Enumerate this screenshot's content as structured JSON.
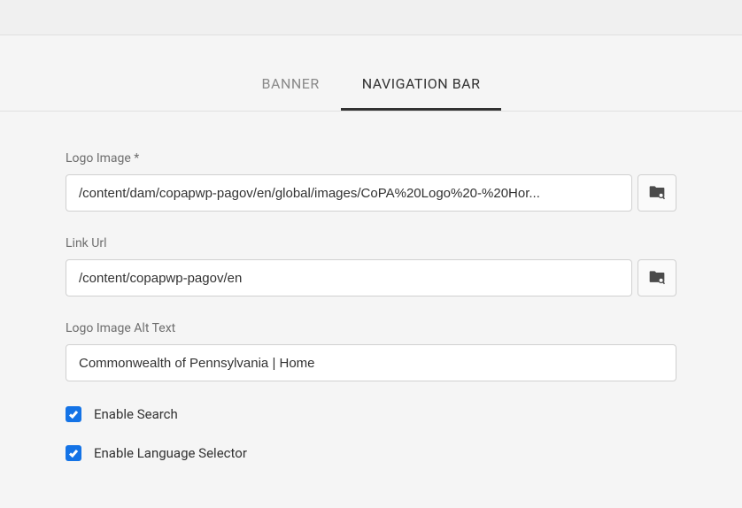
{
  "tabs": {
    "banner": "BANNER",
    "navigation_bar": "NAVIGATION BAR"
  },
  "fields": {
    "logo_image": {
      "label": "Logo Image *",
      "value": "/content/dam/copapwp-pagov/en/global/images/CoPA%20Logo%20-%20Hor..."
    },
    "link_url": {
      "label": "Link Url",
      "value": "/content/copapwp-pagov/en"
    },
    "alt_text": {
      "label": "Logo Image Alt Text",
      "value": "Commonwealth of Pennsylvania | Home"
    }
  },
  "checkboxes": {
    "enable_search": {
      "label": "Enable Search",
      "checked": true
    },
    "enable_language": {
      "label": "Enable Language Selector",
      "checked": true
    }
  }
}
